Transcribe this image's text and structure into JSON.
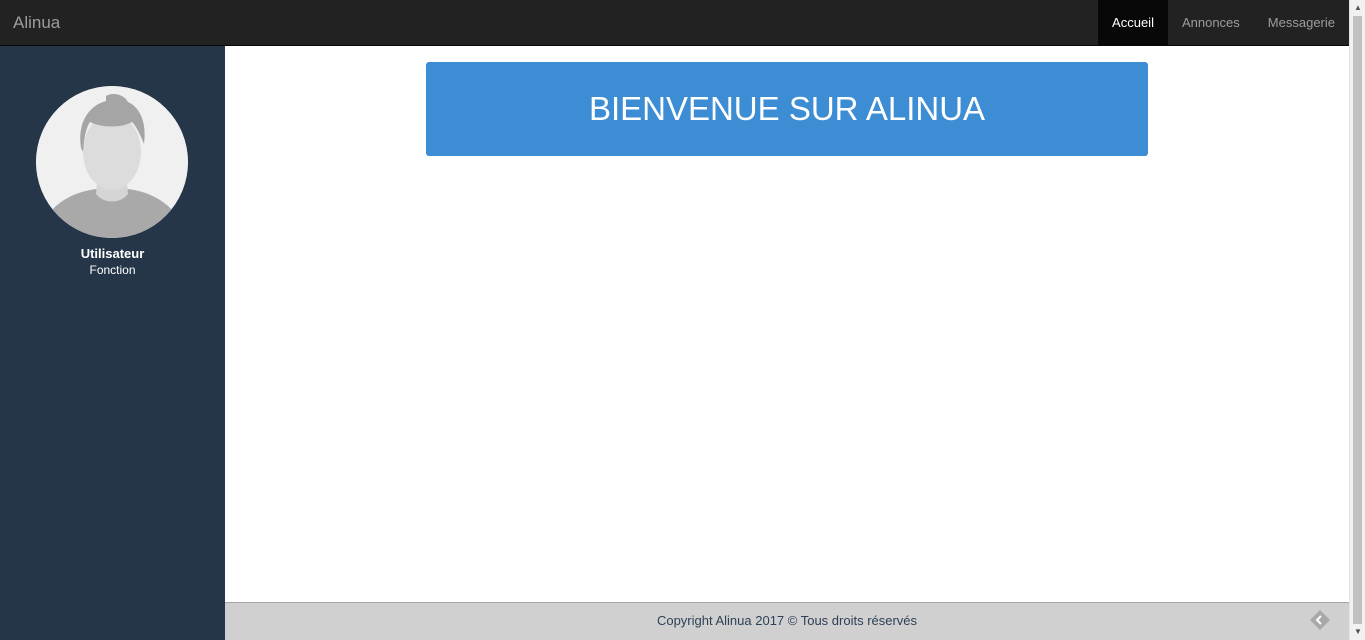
{
  "navbar": {
    "brand": "Alinua",
    "items": [
      {
        "label": "Accueil",
        "active": true
      },
      {
        "label": "Annonces",
        "active": false
      },
      {
        "label": "Messagerie",
        "active": false
      }
    ]
  },
  "sidebar": {
    "avatar_icon": "user-silhouette-icon",
    "user_name": "Utilisateur",
    "user_role": "Fonction"
  },
  "main": {
    "banner_title": "BIENVENUE SUR ALINUA"
  },
  "footer": {
    "copyright": "Copyright Alinua 2017 © Tous droits réservés",
    "corner_icon": "diamond-arrow-icon"
  },
  "colors": {
    "navbar": "#222222",
    "navbar_active": "#080808",
    "sidebar": "#253648",
    "banner": "#3c8dd3",
    "footer": "#d0d0d0"
  }
}
